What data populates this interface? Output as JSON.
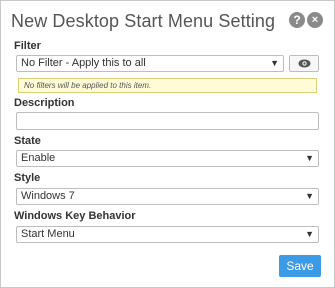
{
  "dialog": {
    "title": "New Desktop Start Menu Setting",
    "help_icon": "?",
    "close_icon": "×"
  },
  "filter": {
    "label": "Filter",
    "value": "No Filter - Apply this to all",
    "note": "No filters will be applied to this item."
  },
  "description": {
    "label": "Description",
    "value": ""
  },
  "state": {
    "label": "State",
    "value": "Enable"
  },
  "style": {
    "label": "Style",
    "value": "Windows 7"
  },
  "windows_key_behavior": {
    "label": "Windows Key Behavior",
    "value": "Start Menu"
  },
  "actions": {
    "save_label": "Save"
  },
  "icons": {
    "help": "help-icon",
    "close": "close-icon",
    "chevron": "chevron-down-icon",
    "eye": "eye-icon"
  }
}
